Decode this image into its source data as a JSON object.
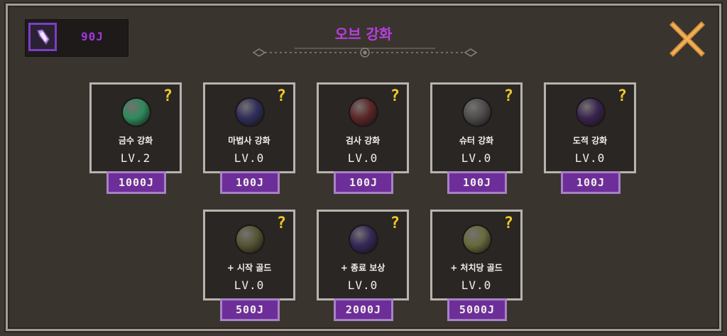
{
  "currency": {
    "amount": "90J"
  },
  "title": "오브 강화",
  "colors": {
    "accent": "#b83fe0",
    "question": "#f2c928",
    "price_bg": "#6d2e9a"
  },
  "cards": [
    {
      "name": "금수 강화",
      "level": "LV.2",
      "price": "1000J",
      "orb_color": "#2e8a5c"
    },
    {
      "name": "마법사 강화",
      "level": "LV.0",
      "price": "100J",
      "orb_color": "#2f2e5c"
    },
    {
      "name": "검사 강화",
      "level": "LV.0",
      "price": "100J",
      "orb_color": "#5c2626"
    },
    {
      "name": "슈터 강화",
      "level": "LV.0",
      "price": "100J",
      "orb_color": "#4d4b4b"
    },
    {
      "name": "도적 강화",
      "level": "LV.0",
      "price": "100J",
      "orb_color": "#3a2350"
    },
    {
      "name": "+ 시작 골드",
      "level": "LV.0",
      "price": "500J",
      "orb_color": "#555433"
    },
    {
      "name": "+ 종료 보상",
      "level": "LV.0",
      "price": "2000J",
      "orb_color": "#33285a"
    },
    {
      "name": "+ 처치당 골드",
      "level": "LV.0",
      "price": "5000J",
      "orb_color": "#676a3c"
    }
  ],
  "help_label": "?",
  "icons": {
    "currency": "orb-shard-icon",
    "close": "close-x-icon",
    "help": "question-mark-icon"
  }
}
